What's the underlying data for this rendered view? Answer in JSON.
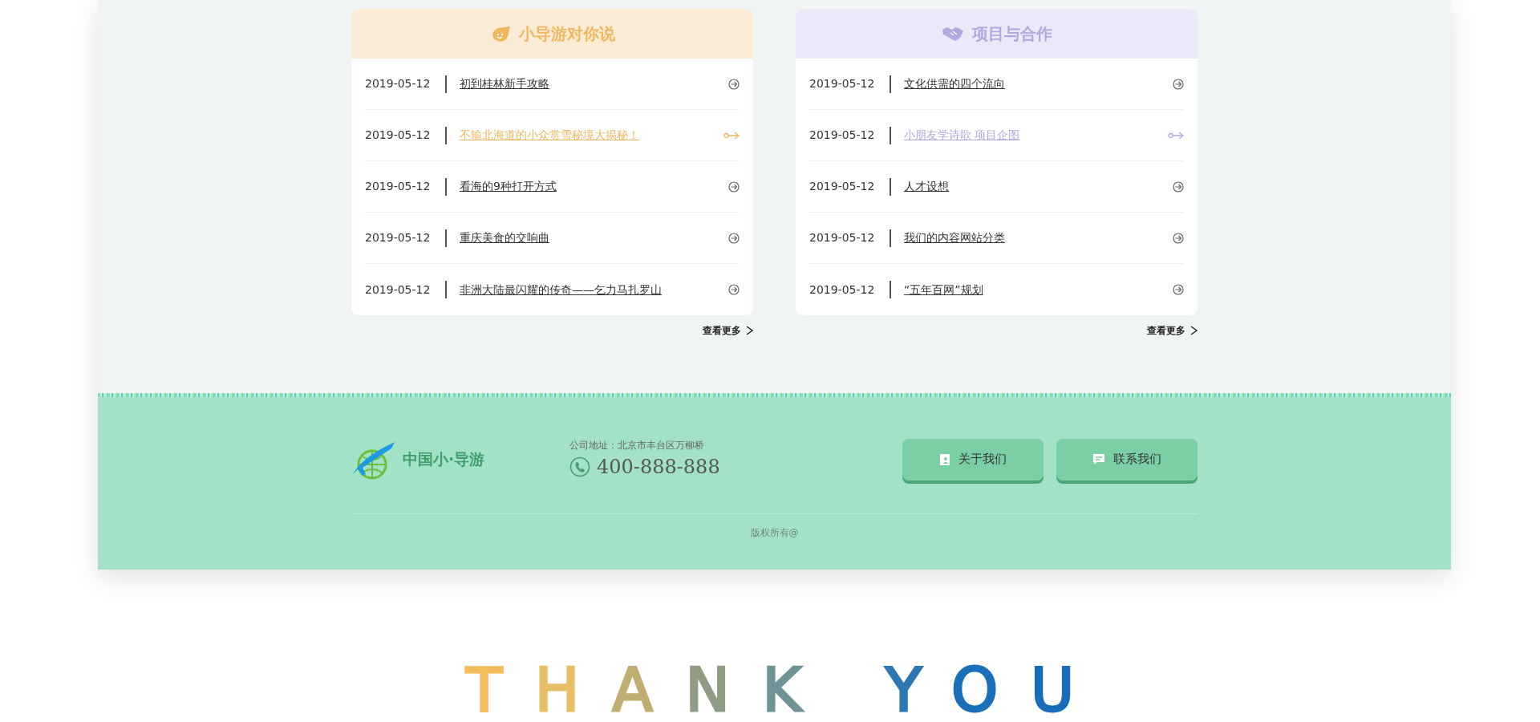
{
  "panels": [
    {
      "title": "小导游对你说",
      "color": "#f0b660",
      "more": "查看更多",
      "items": [
        {
          "date": "2019-05-12",
          "title": "初到桂林新手攻略",
          "selected": false
        },
        {
          "date": "2019-05-12",
          "title": "不输北海道的小众赏雪秘境大揭秘！",
          "selected": true
        },
        {
          "date": "2019-05-12",
          "title": "看海的9种打开方式",
          "selected": false
        },
        {
          "date": "2019-05-12",
          "title": "重庆美食的交响曲",
          "selected": false
        },
        {
          "date": "2019-05-12",
          "title": "非洲大陆最闪耀的传奇——乞力马扎罗山",
          "selected": false
        }
      ]
    },
    {
      "title": "项目与合作",
      "color": "#b3a7e0",
      "more": "查看更多",
      "items": [
        {
          "date": "2019-05-12",
          "title": "文化供需的四个流向",
          "selected": false
        },
        {
          "date": "2019-05-12",
          "title": "小朋友学诗歌 项目企图",
          "selected": true
        },
        {
          "date": "2019-05-12",
          "title": "人才设想",
          "selected": false
        },
        {
          "date": "2019-05-12",
          "title": "我们的内容网站分类",
          "selected": false
        },
        {
          "date": "2019-05-12",
          "title": "“五年百网”规划",
          "selected": false
        }
      ]
    }
  ],
  "footer": {
    "logo_text": "中国小·导游",
    "address": "公司地址：北京市丰台区万柳桥",
    "phone": "400-888-888",
    "buttons": [
      {
        "label": "关于我们",
        "kind": "about"
      },
      {
        "label": "联系我们",
        "kind": "contact"
      }
    ],
    "copyright": "版权所有@"
  },
  "closing": "THANK YOU"
}
